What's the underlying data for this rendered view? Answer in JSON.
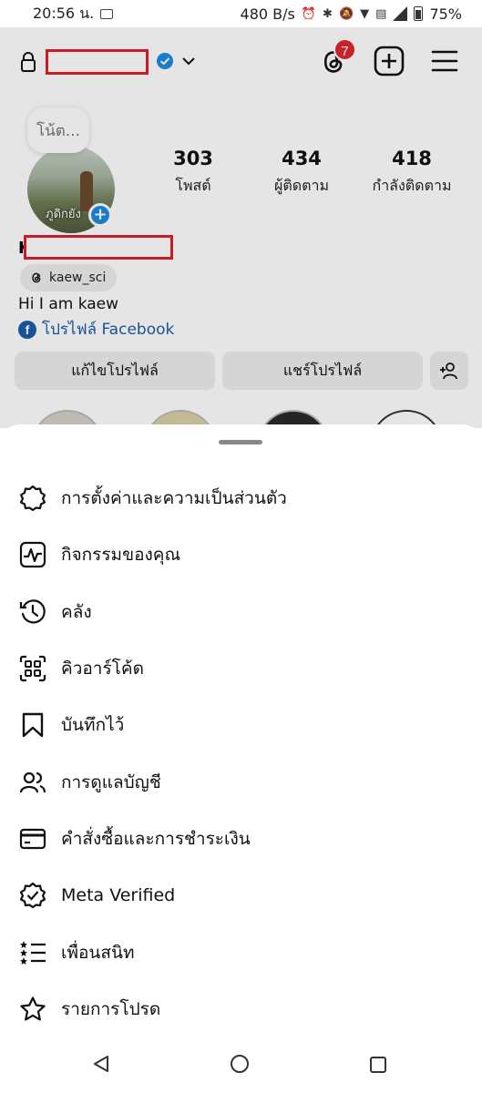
{
  "status_bar": {
    "time": "20:56 น.",
    "network_speed": "480 B/s",
    "battery": "75%"
  },
  "header": {
    "notification_count": "7"
  },
  "profile": {
    "note_placeholder": "โน้ต...",
    "avatar_caption": "ภูดิกยัง",
    "name_initial": "K",
    "stats": [
      {
        "value": "303",
        "label": "โพสต์"
      },
      {
        "value": "434",
        "label": "ผู้ติดตาม"
      },
      {
        "value": "418",
        "label": "กำลังติดตาม"
      }
    ],
    "threads_handle": "kaew_sci",
    "bio": "Hi  I am kaew",
    "facebook_link": "โปรไฟล์ Facebook",
    "edit_profile_label": "แก้ไขโปรไฟล์",
    "share_profile_label": "แชร์โปรไฟล์"
  },
  "menu": {
    "items": [
      {
        "label": "การตั้งค่าและความเป็นส่วนตัว",
        "icon": "settings-gear-icon"
      },
      {
        "label": "กิจกรรมของคุณ",
        "icon": "activity-icon"
      },
      {
        "label": "คลัง",
        "icon": "archive-history-icon"
      },
      {
        "label": "คิวอาร์โค้ด",
        "icon": "qr-code-icon"
      },
      {
        "label": "บันทึกไว้",
        "icon": "bookmark-icon"
      },
      {
        "label": "การดูแลบัญชี",
        "icon": "supervision-icon"
      },
      {
        "label": "คำสั่งซื้อและการชำระเงิน",
        "icon": "card-icon"
      },
      {
        "label": "Meta Verified",
        "icon": "verified-badge-icon"
      },
      {
        "label": "เพื่อนสนิท",
        "icon": "close-friends-icon"
      },
      {
        "label": "รายการโปรด",
        "icon": "star-icon"
      }
    ]
  },
  "colors": {
    "accent_blue": "#1d8ce0",
    "badge_red": "#e0272f",
    "link_blue": "#1d5da6",
    "redaction_red": "#e2202a"
  }
}
